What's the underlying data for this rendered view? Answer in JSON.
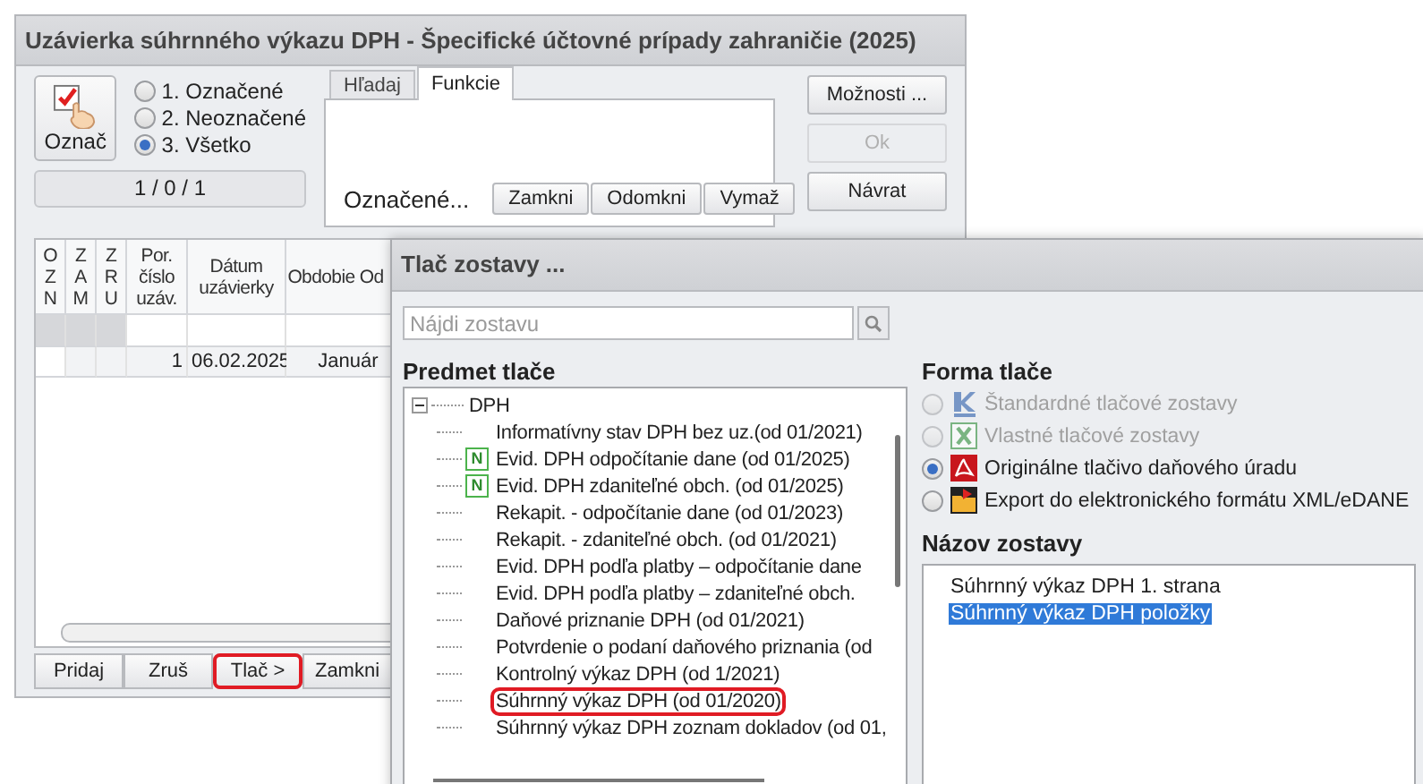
{
  "window": {
    "title": "Uzávierka súhrnného výkazu DPH - Špecifické účtovné prípady zahraničie (2025)"
  },
  "mark_button": {
    "label": "Označ"
  },
  "filter_options": [
    {
      "label": "1. Označené",
      "selected": false
    },
    {
      "label": "2. Neoznačené",
      "selected": false
    },
    {
      "label": "3. Všetko",
      "selected": true
    }
  ],
  "counter": "1 / 0 / 1",
  "tabs": [
    {
      "label": "Hľadaj",
      "selected": false
    },
    {
      "label": "Funkcie",
      "selected": true
    }
  ],
  "functions": {
    "label": "Označené...",
    "buttons": [
      "Zamkni",
      "Odomkni",
      "Vymaž"
    ]
  },
  "side_buttons": [
    {
      "label": "Možnosti ...",
      "disabled": false
    },
    {
      "label": "Ok",
      "disabled": true
    },
    {
      "label": "Návrat",
      "disabled": false
    }
  ],
  "table": {
    "columns": [
      {
        "label": "OZN",
        "kind": "vertical"
      },
      {
        "label": "ZAM",
        "kind": "vertical"
      },
      {
        "label": "ZRU",
        "kind": "vertical"
      },
      {
        "label": "Por. číslo uzáv.",
        "kind": "text"
      },
      {
        "label": "Dátum uzávierky",
        "kind": "text"
      },
      {
        "label": "Obdobie Od",
        "kind": "text"
      }
    ],
    "rows": [
      {
        "number": "1",
        "date": "06.02.2025",
        "period": "Január"
      }
    ]
  },
  "bottom_buttons": [
    {
      "label": "Pridaj",
      "highlighted": false
    },
    {
      "label": "Zruš",
      "highlighted": false
    },
    {
      "label": "Tlač >",
      "highlighted": true
    },
    {
      "label": "Zamkni",
      "highlighted": false
    }
  ],
  "dialog": {
    "title": "Tlač zostavy ...",
    "search": {
      "placeholder": "Nájdi zostavu"
    },
    "tree_heading": "Predmet tlače",
    "tree": [
      {
        "label": "DPH",
        "expanded": true,
        "children": [
          {
            "label": "Informatívny stav DPH bez uz.(od 01/2021)",
            "highlighted": false
          },
          {
            "label": "Evid. DPH odpočítanie dane (od 01/2025)",
            "badge": "N",
            "highlighted": false
          },
          {
            "label": "Evid. DPH zdaniteľné obch. (od 01/2025)",
            "badge": "N",
            "highlighted": false
          },
          {
            "label": "Rekapit. - odpočítanie dane (od 01/2023)",
            "highlighted": false
          },
          {
            "label": "Rekapit. - zdaniteľné obch. (od 01/2021)",
            "highlighted": false
          },
          {
            "label": "Evid. DPH podľa platby – odpočítanie dane",
            "highlighted": false
          },
          {
            "label": "Evid. DPH podľa platby – zdaniteľné obch.",
            "highlighted": false
          },
          {
            "label": "Daňové priznanie DPH (od 01/2021)",
            "highlighted": false
          },
          {
            "label": "Potvrdenie o podaní daňového priznania (od",
            "highlighted": false
          },
          {
            "label": "Kontrolný výkaz DPH (od 1/2021)",
            "highlighted": false
          },
          {
            "label": "Súhrnný výkaz DPH (od 01/2020)",
            "highlighted": true
          },
          {
            "label": "Súhrnný výkaz DPH zoznam dokladov (od 01,",
            "highlighted": false
          }
        ]
      }
    ],
    "format_heading": "Forma tlače",
    "formats": [
      {
        "label": "Štandardné tlačové zostavy",
        "kind": "kros",
        "disabled": true,
        "selected": false
      },
      {
        "label": "Vlastné tlačové zostavy",
        "kind": "excel",
        "disabled": true,
        "selected": false
      },
      {
        "label": "Originálne tlačivo daňového úradu",
        "kind": "pdf",
        "disabled": false,
        "selected": true
      },
      {
        "label": "Export do elektronického formátu XML/eDANE",
        "kind": "export",
        "disabled": false,
        "selected": false
      }
    ],
    "report_heading": "Názov zostavy",
    "reports": [
      {
        "label": "Súhrnný výkaz DPH 1. strana",
        "selected": false
      },
      {
        "label": "Súhrnný výkaz DPH položky",
        "selected": true
      }
    ]
  }
}
